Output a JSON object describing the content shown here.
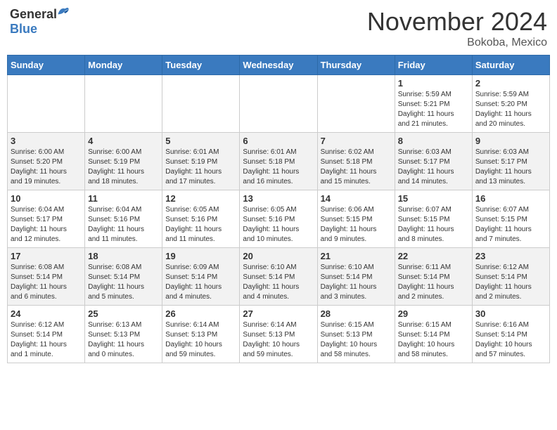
{
  "header": {
    "logo_general": "General",
    "logo_blue": "Blue",
    "month": "November 2024",
    "location": "Bokoba, Mexico"
  },
  "weekdays": [
    "Sunday",
    "Monday",
    "Tuesday",
    "Wednesday",
    "Thursday",
    "Friday",
    "Saturday"
  ],
  "weeks": [
    [
      {
        "day": "",
        "info": ""
      },
      {
        "day": "",
        "info": ""
      },
      {
        "day": "",
        "info": ""
      },
      {
        "day": "",
        "info": ""
      },
      {
        "day": "",
        "info": ""
      },
      {
        "day": "1",
        "info": "Sunrise: 5:59 AM\nSunset: 5:21 PM\nDaylight: 11 hours\nand 21 minutes."
      },
      {
        "day": "2",
        "info": "Sunrise: 5:59 AM\nSunset: 5:20 PM\nDaylight: 11 hours\nand 20 minutes."
      }
    ],
    [
      {
        "day": "3",
        "info": "Sunrise: 6:00 AM\nSunset: 5:20 PM\nDaylight: 11 hours\nand 19 minutes."
      },
      {
        "day": "4",
        "info": "Sunrise: 6:00 AM\nSunset: 5:19 PM\nDaylight: 11 hours\nand 18 minutes."
      },
      {
        "day": "5",
        "info": "Sunrise: 6:01 AM\nSunset: 5:19 PM\nDaylight: 11 hours\nand 17 minutes."
      },
      {
        "day": "6",
        "info": "Sunrise: 6:01 AM\nSunset: 5:18 PM\nDaylight: 11 hours\nand 16 minutes."
      },
      {
        "day": "7",
        "info": "Sunrise: 6:02 AM\nSunset: 5:18 PM\nDaylight: 11 hours\nand 15 minutes."
      },
      {
        "day": "8",
        "info": "Sunrise: 6:03 AM\nSunset: 5:17 PM\nDaylight: 11 hours\nand 14 minutes."
      },
      {
        "day": "9",
        "info": "Sunrise: 6:03 AM\nSunset: 5:17 PM\nDaylight: 11 hours\nand 13 minutes."
      }
    ],
    [
      {
        "day": "10",
        "info": "Sunrise: 6:04 AM\nSunset: 5:17 PM\nDaylight: 11 hours\nand 12 minutes."
      },
      {
        "day": "11",
        "info": "Sunrise: 6:04 AM\nSunset: 5:16 PM\nDaylight: 11 hours\nand 11 minutes."
      },
      {
        "day": "12",
        "info": "Sunrise: 6:05 AM\nSunset: 5:16 PM\nDaylight: 11 hours\nand 11 minutes."
      },
      {
        "day": "13",
        "info": "Sunrise: 6:05 AM\nSunset: 5:16 PM\nDaylight: 11 hours\nand 10 minutes."
      },
      {
        "day": "14",
        "info": "Sunrise: 6:06 AM\nSunset: 5:15 PM\nDaylight: 11 hours\nand 9 minutes."
      },
      {
        "day": "15",
        "info": "Sunrise: 6:07 AM\nSunset: 5:15 PM\nDaylight: 11 hours\nand 8 minutes."
      },
      {
        "day": "16",
        "info": "Sunrise: 6:07 AM\nSunset: 5:15 PM\nDaylight: 11 hours\nand 7 minutes."
      }
    ],
    [
      {
        "day": "17",
        "info": "Sunrise: 6:08 AM\nSunset: 5:14 PM\nDaylight: 11 hours\nand 6 minutes."
      },
      {
        "day": "18",
        "info": "Sunrise: 6:08 AM\nSunset: 5:14 PM\nDaylight: 11 hours\nand 5 minutes."
      },
      {
        "day": "19",
        "info": "Sunrise: 6:09 AM\nSunset: 5:14 PM\nDaylight: 11 hours\nand 4 minutes."
      },
      {
        "day": "20",
        "info": "Sunrise: 6:10 AM\nSunset: 5:14 PM\nDaylight: 11 hours\nand 4 minutes."
      },
      {
        "day": "21",
        "info": "Sunrise: 6:10 AM\nSunset: 5:14 PM\nDaylight: 11 hours\nand 3 minutes."
      },
      {
        "day": "22",
        "info": "Sunrise: 6:11 AM\nSunset: 5:14 PM\nDaylight: 11 hours\nand 2 minutes."
      },
      {
        "day": "23",
        "info": "Sunrise: 6:12 AM\nSunset: 5:14 PM\nDaylight: 11 hours\nand 2 minutes."
      }
    ],
    [
      {
        "day": "24",
        "info": "Sunrise: 6:12 AM\nSunset: 5:14 PM\nDaylight: 11 hours\nand 1 minute."
      },
      {
        "day": "25",
        "info": "Sunrise: 6:13 AM\nSunset: 5:13 PM\nDaylight: 11 hours\nand 0 minutes."
      },
      {
        "day": "26",
        "info": "Sunrise: 6:14 AM\nSunset: 5:13 PM\nDaylight: 10 hours\nand 59 minutes."
      },
      {
        "day": "27",
        "info": "Sunrise: 6:14 AM\nSunset: 5:13 PM\nDaylight: 10 hours\nand 59 minutes."
      },
      {
        "day": "28",
        "info": "Sunrise: 6:15 AM\nSunset: 5:13 PM\nDaylight: 10 hours\nand 58 minutes."
      },
      {
        "day": "29",
        "info": "Sunrise: 6:15 AM\nSunset: 5:14 PM\nDaylight: 10 hours\nand 58 minutes."
      },
      {
        "day": "30",
        "info": "Sunrise: 6:16 AM\nSunset: 5:14 PM\nDaylight: 10 hours\nand 57 minutes."
      }
    ]
  ]
}
